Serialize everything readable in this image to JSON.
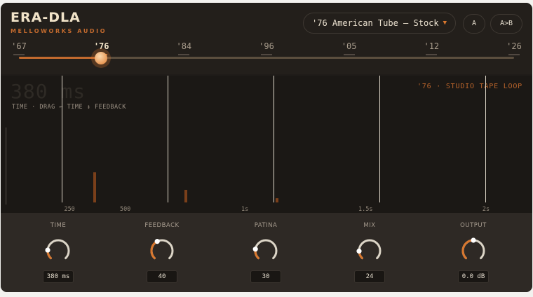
{
  "brand": {
    "title": "ERA-DLA",
    "subtitle": "MELLOWORKS AUDIO"
  },
  "preset": {
    "label": "'76 American Tube — Stock"
  },
  "compare": {
    "a_label": "A",
    "ab_label": "A>B"
  },
  "eras": [
    {
      "label": "'67",
      "active": false
    },
    {
      "label": "'76",
      "active": true
    },
    {
      "label": "'84",
      "active": false
    },
    {
      "label": "'96",
      "active": false
    },
    {
      "label": "'05",
      "active": false
    },
    {
      "label": "'12",
      "active": false
    },
    {
      "label": "'26",
      "active": false
    }
  ],
  "era_slider": {
    "selected": "'76",
    "position_fraction": 0.167
  },
  "display": {
    "readout_value": "380 ms",
    "hint": "TIME  ·  DRAG ↔ TIME ↕ FEEDBACK",
    "mode": "'76  ·  STUDIO TAPE LOOP",
    "time_ticks": [
      "250",
      "500",
      "1s",
      "1.5s",
      "2s"
    ],
    "taps_ms": [
      0,
      380,
      760,
      1140,
      1520
    ],
    "echo_levels": [
      0.24,
      0.1,
      0.035
    ]
  },
  "knobs": [
    {
      "name": "time",
      "title": "TIME",
      "value": "380 ms",
      "level": 0.18
    },
    {
      "name": "feedback",
      "title": "FEEDBACK",
      "value": "40",
      "level": 0.4
    },
    {
      "name": "patina",
      "title": "PATINA",
      "value": "30",
      "level": 0.2
    },
    {
      "name": "mix",
      "title": "MIX",
      "value": "24",
      "level": 0.16
    },
    {
      "name": "output",
      "title": "OUTPUT",
      "value": "0.0 dB",
      "level": 0.5
    }
  ],
  "colors": {
    "accent": "#d9772e",
    "track": "#dcd5c7",
    "panel": "#1f1c19"
  }
}
